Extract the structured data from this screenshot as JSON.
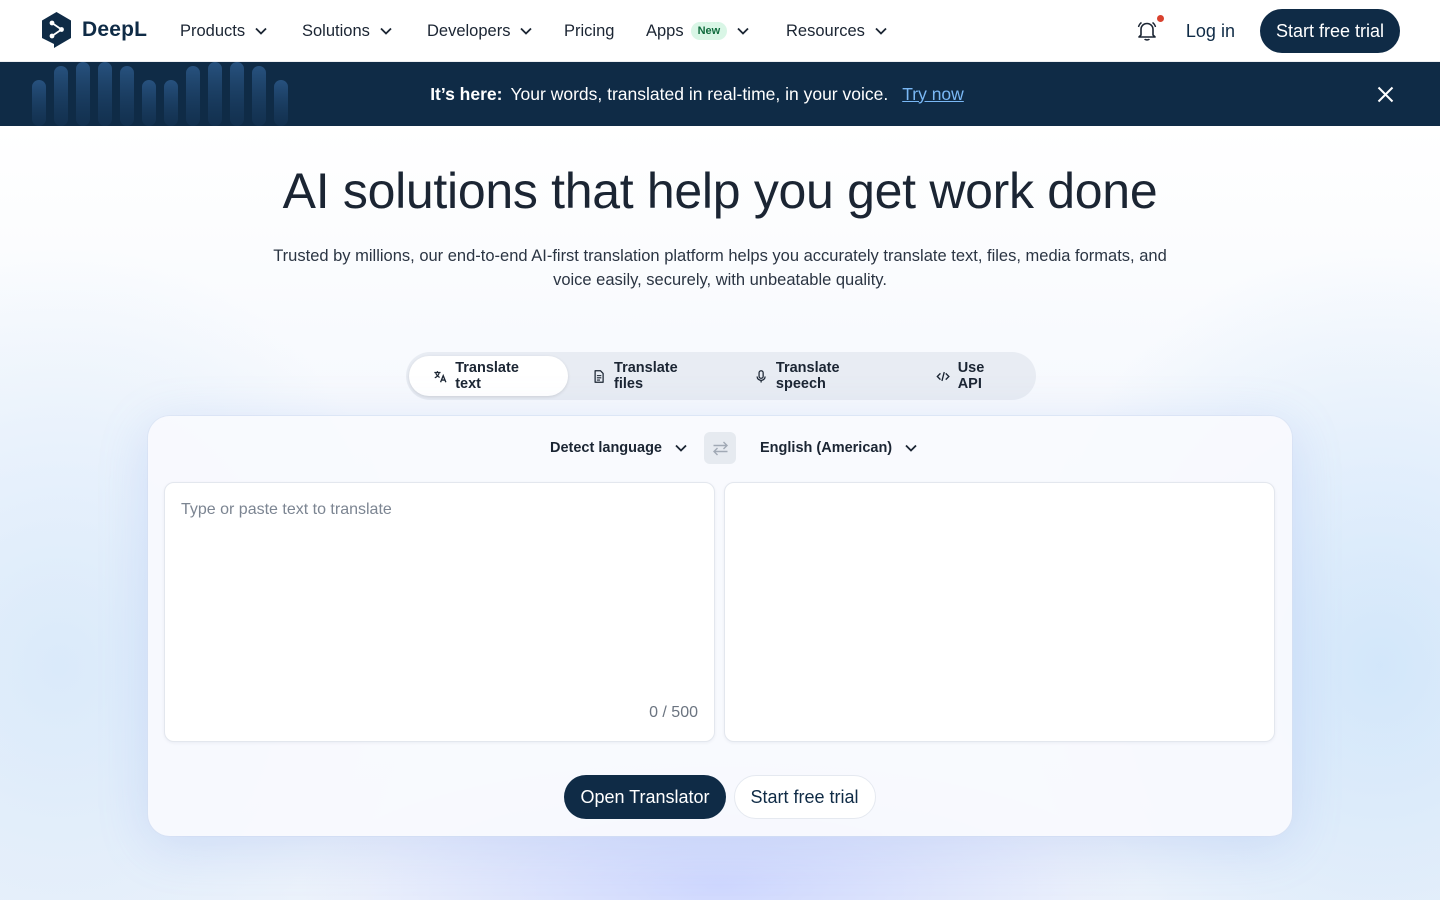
{
  "nav": {
    "logo_text": "DeepL",
    "items": [
      {
        "label": "Products",
        "dropdown": true
      },
      {
        "label": "Solutions",
        "dropdown": true
      },
      {
        "label": "Developers",
        "dropdown": true
      },
      {
        "label": "Pricing",
        "dropdown": false
      },
      {
        "label": "Apps",
        "badge": "New",
        "dropdown": true
      },
      {
        "label": "Resources",
        "dropdown": true
      }
    ],
    "login_label": "Log in",
    "cta_label": "Start free trial",
    "icons": {
      "notifications": "bell-icon",
      "dropdown": "chevron-down-icon"
    }
  },
  "banner": {
    "strong": "It’s here:",
    "text": "Your words, translated in real-time, in your voice.",
    "link": "Try now",
    "close_icon": "close-icon"
  },
  "hero": {
    "title": "AI solutions that help you get work done",
    "subtitle": "Trusted by millions, our end-to-end AI-first translation platform helps you accurately translate text, files, media formats, and voice easily, securely, with unbeatable quality."
  },
  "tabs": [
    {
      "label": "Translate text",
      "icon": "translate-icon",
      "active": true
    },
    {
      "label": "Translate files",
      "icon": "file-icon",
      "active": false
    },
    {
      "label": "Translate speech",
      "icon": "microphone-icon",
      "active": false
    },
    {
      "label": "Use API",
      "icon": "code-icon",
      "active": false
    }
  ],
  "translator": {
    "source_language": "Detect language",
    "target_language": "English (American)",
    "swap_icon": "swap-icon",
    "source_placeholder": "Type or paste text to translate",
    "source_value": "",
    "char_count": "0 / 500",
    "target_text": "",
    "open_label": "Open Translator",
    "trial_label": "Start free trial"
  },
  "colors": {
    "brand_navy": "#0f2b46",
    "link_blue": "#7ab8f5",
    "badge_green_bg": "#d9f6e6",
    "notification_dot": "#d9412e"
  }
}
